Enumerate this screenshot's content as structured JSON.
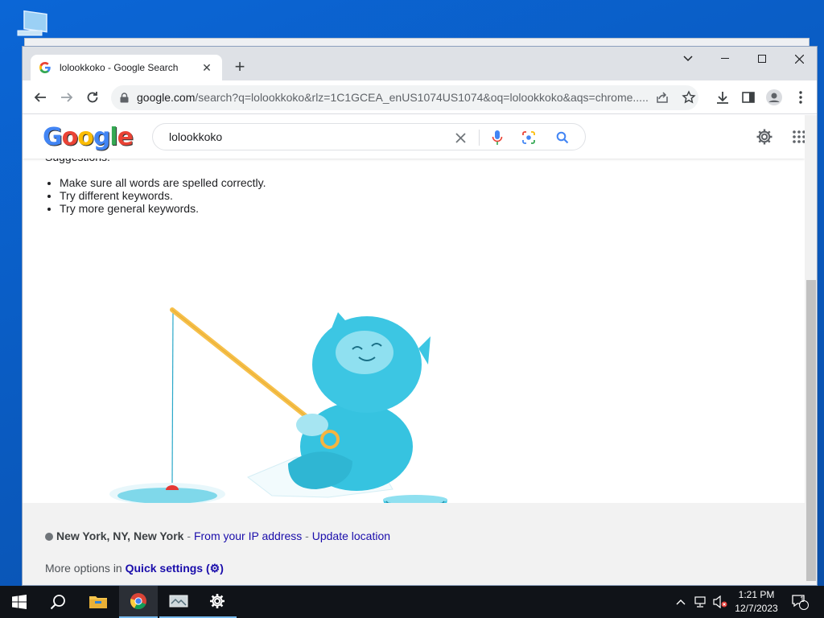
{
  "browser": {
    "tab_title": "lolookkoko - Google Search",
    "url_host": "google.com",
    "url_rest": "/search?q=lolookkoko&rlz=1C1GCEA_enUS1074US1074&oq=lolookkoko&aqs=chrome....."
  },
  "search": {
    "query": "lolookkoko"
  },
  "results": {
    "suggestions_title": "Suggestions:",
    "suggestions": [
      "Make sure all words are spelled correctly.",
      "Try different keywords.",
      "Try more general keywords."
    ]
  },
  "footer": {
    "location": "New York, NY, New York",
    "sep1": " - ",
    "ip_link": "From your IP address",
    "sep2": " - ",
    "update_link": "Update location",
    "more_prefix": "More options in ",
    "quick_settings": "Quick settings ("
  },
  "taskbar": {
    "time": "1:21 PM",
    "date": "12/7/2023",
    "notification_count": "1"
  },
  "colors": {
    "desktop": "#0a5fc4",
    "link": "#1a0dab",
    "accent_blue": "#4285f4"
  }
}
